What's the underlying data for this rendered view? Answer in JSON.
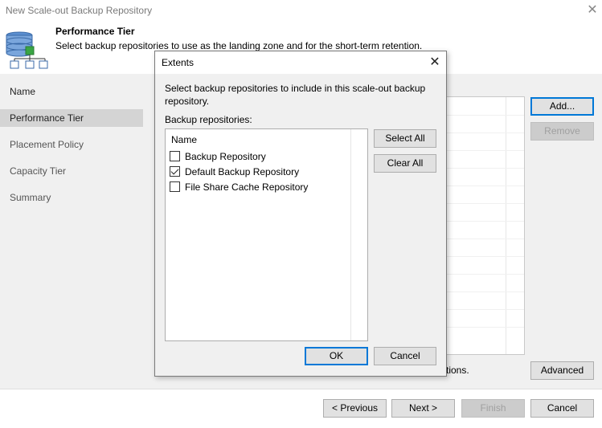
{
  "window": {
    "title": "New Scale-out Backup Repository",
    "close_glyph": "✕"
  },
  "header": {
    "title": "Performance Tier",
    "subtitle": "Select backup repositories to use as the landing zone and for the short-term retention.",
    "icon": "database-tree-icon"
  },
  "sidebar": {
    "items": [
      {
        "label": "Name",
        "active": false
      },
      {
        "label": "Performance Tier",
        "active": true
      },
      {
        "label": "Placement Policy",
        "active": false
      },
      {
        "label": "Capacity Tier",
        "active": false
      },
      {
        "label": "Summary",
        "active": false
      }
    ]
  },
  "main": {
    "add_label": "Add...",
    "remove_label": "Remove",
    "advanced_label": "Advanced",
    "tail_text": "tions."
  },
  "footer": {
    "previous_label": "< Previous",
    "next_label": "Next >",
    "finish_label": "Finish",
    "cancel_label": "Cancel"
  },
  "dialog": {
    "title": "Extents",
    "close_glyph": "✕",
    "description": "Select backup repositories to include in this scale-out backup repository.",
    "list_label": "Backup repositories:",
    "column_name": "Name",
    "repositories": [
      {
        "label": "Backup Repository",
        "checked": false
      },
      {
        "label": "Default Backup Repository",
        "checked": true
      },
      {
        "label": "File Share Cache Repository",
        "checked": false
      }
    ],
    "select_all_label": "Select All",
    "clear_all_label": "Clear All",
    "ok_label": "OK",
    "cancel_label": "Cancel"
  },
  "colors": {
    "accent": "#0078d7",
    "icon_blue": "#4a7ebb",
    "icon_green": "#3aa544"
  }
}
